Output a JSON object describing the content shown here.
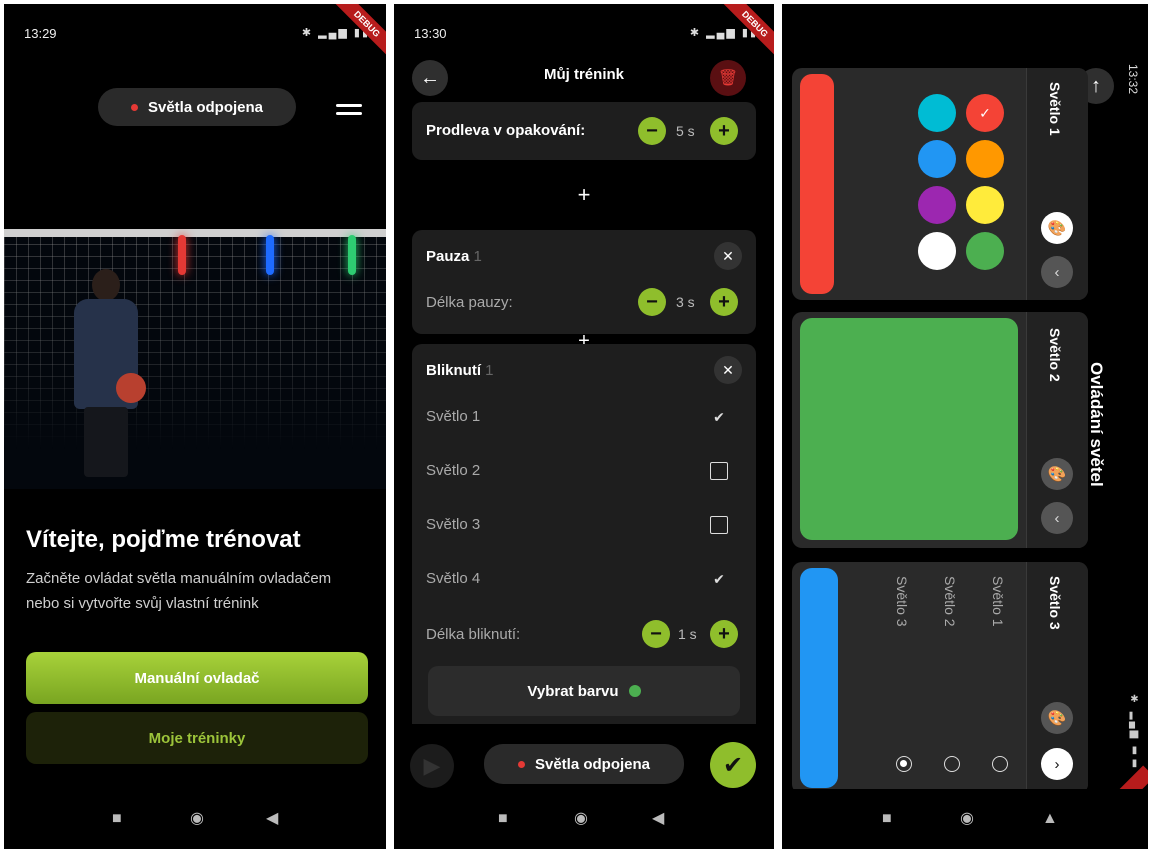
{
  "screen1": {
    "status": {
      "time": "13:29",
      "icons": "✱ ▂▄▆ ▮▮"
    },
    "debug_label": "DEBUG",
    "connection_pill": "Světla odpojena",
    "title": "Vítejte, pojďme trénovat",
    "subtitle": "Začněte ovládat světla manuálním ovladačem nebo si vytvořte svůj vlastní trénink",
    "primary_button": "Manuální ovladač",
    "secondary_button": "Moje tréninky"
  },
  "screen2": {
    "status": {
      "time": "13:30",
      "icons": "✱ ▂▄▆ ▮▮"
    },
    "debug_label": "DEBUG",
    "title": "Můj trénink",
    "repeat_delay": {
      "label": "Prodleva v opakování:",
      "value": "5 s"
    },
    "pause": {
      "title": "Pauza",
      "index": "1",
      "length_label": "Délka pauzy:",
      "length_value": "3 s"
    },
    "blink": {
      "title": "Bliknutí",
      "index": "1",
      "lights": [
        {
          "label": "Světlo 1",
          "checked": true
        },
        {
          "label": "Světlo 2",
          "checked": false
        },
        {
          "label": "Světlo 3",
          "checked": false
        },
        {
          "label": "Světlo 4",
          "checked": true
        }
      ],
      "length_label": "Délka bliknutí:",
      "length_value": "1 s",
      "color_button": "Vybrat barvu"
    },
    "connection_pill": "Světla odpojena",
    "plus_symbol": "+"
  },
  "screen3": {
    "status": {
      "time": "13:32",
      "icons": "✱ ▂▄▆ ▮▮"
    },
    "debug_label": "DEBUG",
    "title": "Ovládání světel",
    "lights": [
      {
        "label": "Světlo 1",
        "color": "#f44336"
      },
      {
        "label": "Světlo 2",
        "color": "#4caf50"
      },
      {
        "label": "Světlo 3",
        "color": "#2196f3"
      }
    ],
    "palette": [
      "#00bcd4",
      "#f44336",
      "#2196f3",
      "#ff9800",
      "#9c27b0",
      "#ffeb3b",
      "#ffffff",
      "#4caf50"
    ],
    "light3_targets": [
      "Světlo 1",
      "Světlo 2",
      "Světlo 3"
    ]
  },
  "colors": {
    "accent": "#8fbe2c",
    "danger": "#e53935",
    "card": "#1e1e1e",
    "background": "#000000"
  }
}
